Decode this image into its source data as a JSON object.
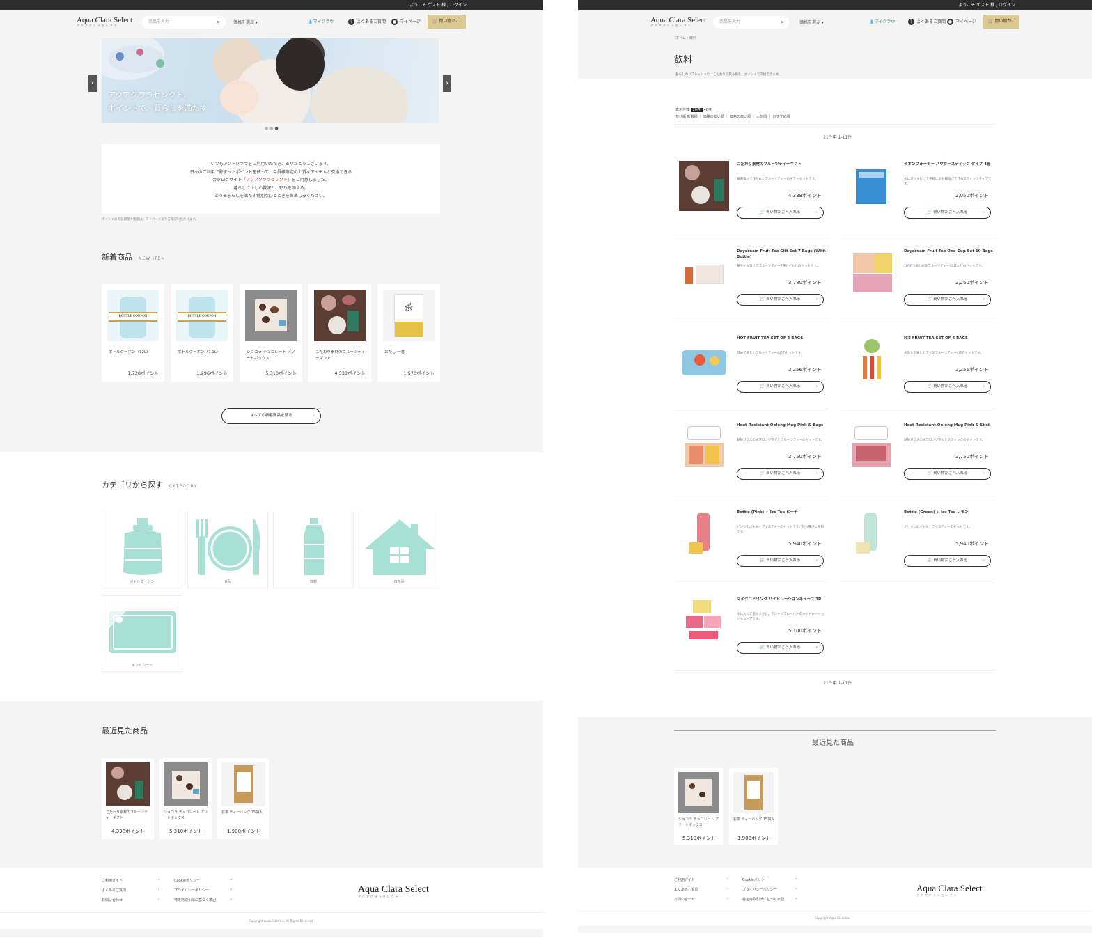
{
  "header": {
    "logo": "Aqua Clara Select",
    "logo_sub": "アクアクララセレクト",
    "search_placeholder": "商品を入力",
    "search_icon": "search-icon",
    "select_label": "価格を選ぶ ▾",
    "mypoint_label": "マイクラウ",
    "faq_label": "よくあるご質問",
    "mypage_label": "マイページ",
    "cart_label": "買い物かご"
  },
  "left": {
    "topbar": "ようこそ ゲスト 様 / ログイン",
    "hero": {
      "line1": "アクアクララセレクト。",
      "line2": "ポイントで、暮らしを満たす"
    },
    "notice": {
      "line1": "いつもアクアクララをご利用いただき、ありがとうございます。",
      "line2": "日々のご利用で貯まったポイントを使って、会員様限定の上質なアイテムと交換できる",
      "line3_pre": "カタログサイト",
      "line3_brand": "「アクアクララセレクト」",
      "line3_post": "をご用意しました。",
      "line4": "暮らしに少しの贅沢と、彩りを添える。",
      "line5": "どうぞ暮らしを満たす特別なひとときをお楽しみください。"
    },
    "small_note": "ポイントの有効期限や残高は、マイページよりご確認いただけます。",
    "new_items": {
      "title": "新着商品",
      "title_en": "NEW ITEM",
      "more_label": "すべての新着商品を見る",
      "items": [
        {
          "name": "ボトルクーポン（12L）",
          "price": "1,728ポイント"
        },
        {
          "name": "ボトルクーポン（7.1L）",
          "price": "1,296ポイント"
        },
        {
          "name": "ショコラ チョコレート アソートボックス",
          "price": "5,310ポイント"
        },
        {
          "name": "こだわり素材のフルーツティーギフト",
          "price": "4,338ポイント"
        },
        {
          "name": "おだし 一番",
          "price": "1,570ポイント"
        }
      ]
    },
    "categories": {
      "title": "カテゴリから探す",
      "title_en": "CATEGORY",
      "items": [
        {
          "label": "ボトルクーポン",
          "icon": "water-bottle-icon"
        },
        {
          "label": "食品",
          "icon": "food-plate-icon"
        },
        {
          "label": "飲料",
          "icon": "drink-bottle-icon"
        },
        {
          "label": "日用品",
          "icon": "house-icon"
        },
        {
          "label": "ギフトカード",
          "icon": "gift-card-icon"
        }
      ]
    },
    "recent": {
      "title": "最近見た商品",
      "items": [
        {
          "name": "こだわり素材のフルーツティーギフト",
          "price": "4,338ポイント"
        },
        {
          "name": "ショコラ チョコレート アソートボックス",
          "price": "5,310ポイント"
        },
        {
          "name": "お茶 ティーバッグ 15袋入",
          "price": "1,900ポイント"
        }
      ]
    },
    "footer": {
      "col1": [
        "ご利用ガイド",
        "よくあるご質問",
        "お問い合わせ"
      ],
      "col2": [
        "Cookieポリシー",
        "プライバシーポリシー",
        "特定商取引法に基づく表記"
      ],
      "copyright": "Copyright Aqua Clara Inc. All Rights Reserved."
    }
  },
  "right": {
    "topbar": "ようこそ ゲスト 様 / ログイン",
    "breadcrumb": "ホーム  ›  飲料",
    "title": "飲料",
    "desc": "暮らしのリフレッシュに、こだわりの飲み物を。ポイントで交換できます。",
    "filters": {
      "row1_label": "表示件数",
      "row1_selected": "20件",
      "row1_other": "40件",
      "row2_label": "並び順",
      "row2_items": "新着順  ｜  価格の安い順  ｜  価格の高い順  ｜  人気順  ｜  おすすめ順"
    },
    "count_top": "11件中 1-11件",
    "count_bottom": "11件中 1-11件",
    "add_label": "買い物かごへ入れる",
    "products": [
      {
        "name": "こだわり素材のフルーツティーギフト",
        "desc": "厳選素材で作られたフルーツティーのギフトセットです。",
        "price": "4,338ポイント"
      },
      {
        "name": "イオンウォーター パウダースティック タイプ 4箱",
        "desc": "水に溶かすだけで手軽に水分補給ができるスティックタイプです。",
        "price": "2,050ポイント"
      },
      {
        "name": "Daydream Fruit Tea Gift Set 7 Bags (With Bottle)",
        "desc": "華やかな香りのフルーツティー7種とボトルのセットです。",
        "price": "3,780ポイント"
      },
      {
        "name": "Daydream Fruit Tea One-Cup Set 10 Bags",
        "desc": "1杯ずつ楽しめるフルーツティー10袋入りのセットです。",
        "price": "2,260ポイント"
      },
      {
        "name": "HOT FRUIT TEA SET OF 4 BAGS",
        "desc": "温めて楽しむフルーツティー4袋のセットです。",
        "price": "2,256ポイント"
      },
      {
        "name": "ICE FRUIT TEA SET OF 4 BAGS",
        "desc": "水出しで楽しむアイスフルーツティー4袋のセットです。",
        "price": "2,256ポイント"
      },
      {
        "name": "Heat Resistant Oblong Mug Pink & Bags",
        "desc": "耐熱ガラスのオブロングマグとフルーツティーのセットです。",
        "price": "2,750ポイント"
      },
      {
        "name": "Heat Resistant Oblong Mug Pink & Stick",
        "desc": "耐熱ガラスのオブロングマグとスティックのセットです。",
        "price": "2,750ポイント"
      },
      {
        "name": "Bottle (Pink) + Ice Tea ピーチ",
        "desc": "ピンクのボトルとアイスティーのセットです。持ち運びに便利です。",
        "price": "5,940ポイント"
      },
      {
        "name": "Bottle (Green) + Ice Tea レモン",
        "desc": "グリーンのボトルとアイスティーのセットです。",
        "price": "5,940ポイント"
      },
      {
        "name": "マイクロドリンク ハイドレーションキューブ 3P",
        "desc": "水に入れて溶かすだけ。フルーツフレーバーのハイドレーションキューブです。",
        "price": "5,100ポイント"
      }
    ],
    "recent": {
      "title": "最近見た商品",
      "items": [
        {
          "name": "ショコラ チョコレート アソートボックス",
          "price": "5,310ポイント"
        },
        {
          "name": "お茶 ティーバッグ 15袋入",
          "price": "1,900ポイント"
        }
      ]
    },
    "footer": {
      "col1": [
        "ご利用ガイド",
        "よくあるご質問",
        "お問い合わせ"
      ],
      "col2": [
        "Cookieポリシー",
        "プライバシーポリシー",
        "特定商取引法に基づく表記"
      ],
      "copyright": "Copyright Aqua Clara Inc."
    }
  }
}
